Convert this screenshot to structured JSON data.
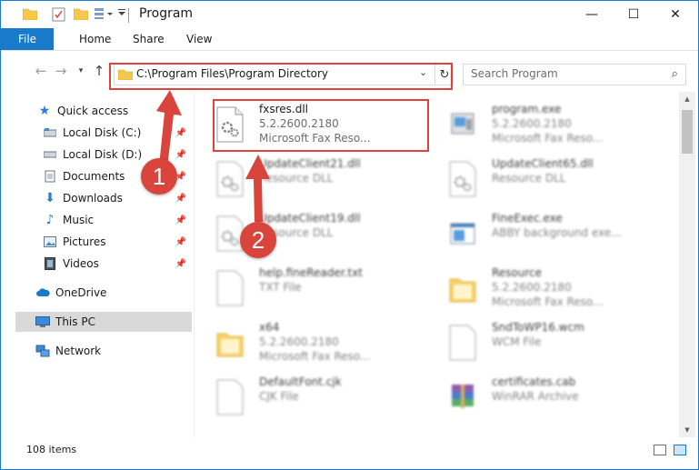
{
  "window": {
    "title": "Program",
    "controls": {
      "minimize": "—",
      "maximize": "☐",
      "close": "✕"
    }
  },
  "ribbon": {
    "tabs": [
      {
        "label": "File"
      },
      {
        "label": "Home"
      },
      {
        "label": "Share"
      },
      {
        "label": "View"
      }
    ]
  },
  "address": {
    "path": "C:\\Program Files\\Program Directory",
    "search_placeholder": "Search Program"
  },
  "sidebar": {
    "quick_access": "Quick access",
    "items": [
      {
        "label": "Local Disk (C:)"
      },
      {
        "label": "Local Disk (D:)"
      },
      {
        "label": "Documents"
      },
      {
        "label": "Downloads"
      },
      {
        "label": "Music"
      },
      {
        "label": "Pictures"
      },
      {
        "label": "Videos"
      }
    ],
    "onedrive": "OneDrive",
    "this_pc": "This PC",
    "network": "Network"
  },
  "files": [
    {
      "name": "fxsres.dll",
      "line1": "5.2.2600.2180",
      "line2": "Microsoft  Fax Reso...",
      "icon": "dll-gear-icon"
    },
    {
      "name": "program.exe",
      "line1": "5.2.2600.2180",
      "line2": "Microsoft  Fax Reso...",
      "icon": "exe-icon"
    },
    {
      "name": "UpdateClient21.dll",
      "line1": "Resource DLL",
      "line2": "",
      "icon": "dll-gear-icon"
    },
    {
      "name": "UpdateClient65.dll",
      "line1": "Resource DLL",
      "line2": "",
      "icon": "dll-gear-icon"
    },
    {
      "name": "UpdateClient19.dll",
      "line1": "Resource DLL",
      "line2": "",
      "icon": "dll-gear-icon"
    },
    {
      "name": "FineExec.exe",
      "line1": "ABBY background exe...",
      "line2": "",
      "icon": "exe-window-icon"
    },
    {
      "name": "help.fineReader.txt",
      "line1": "TXT File",
      "line2": "",
      "icon": "text-file-icon"
    },
    {
      "name": "Resource",
      "line1": "5.2.2600.2180",
      "line2": "Microsoft  Fax Reso...",
      "icon": "folder-icon"
    },
    {
      "name": "x64",
      "line1": "5.2.2600.2180",
      "line2": "Microsoft  Fax Reso...",
      "icon": "folder-icon"
    },
    {
      "name": "SndToWP16.wcm",
      "line1": "WCM File",
      "line2": "",
      "icon": "blank-file-icon"
    },
    {
      "name": "DefaultFont.cjk",
      "line1": "CJK File",
      "line2": "",
      "icon": "blank-file-icon"
    },
    {
      "name": "certificates.cab",
      "line1": "WinRAR Archive",
      "line2": "",
      "icon": "winrar-icon"
    }
  ],
  "status": {
    "items": "108 items"
  },
  "annotations": {
    "step1": "1",
    "step2": "2"
  },
  "colors": {
    "accent": "#1979ca",
    "highlight": "#d9443c",
    "selected": "#d9d9d9"
  }
}
